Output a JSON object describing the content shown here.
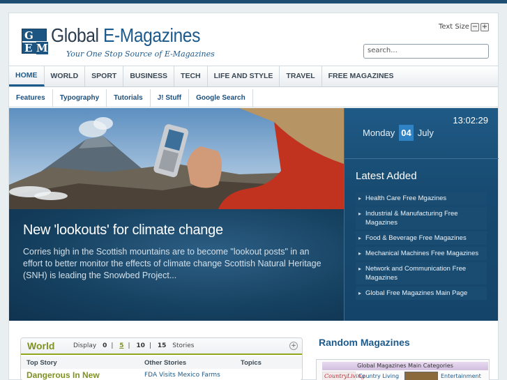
{
  "header": {
    "logo_letters": [
      "G",
      "E",
      "M"
    ],
    "title_part1": "Global ",
    "title_part2": "E-Magazines",
    "tagline": "Your One Stop Source of E-Magazines",
    "text_size_label": "Text Size",
    "text_size_minus": "−",
    "text_size_plus": "+",
    "search_placeholder": "search..."
  },
  "main_nav": [
    "HOME",
    "WORLD",
    "SPORT",
    "BUSINESS",
    "TECH",
    "LIFE AND STYLE",
    "TRAVEL",
    "FREE MAGAZINES"
  ],
  "sub_nav": [
    "Features",
    "Typography",
    "Tutorials",
    "J! Stuff",
    "Google Search"
  ],
  "hero": {
    "title": "New 'lookouts' for climate change",
    "text": "Corries high in the Scottish mountains are to become \"lookout posts\" in an effort to better monitor the effects of climate change Scottish Natural Heritage (SNH) is leading the Snowbed Project..."
  },
  "sidebar": {
    "time": "13:02:29",
    "weekday": "Monday",
    "day": "04",
    "month": "July",
    "latest_title": "Latest Added",
    "latest_items": [
      "Health Care Free Mgazines",
      "Industrial & Manufacturing Free Magazines",
      "Food & Beverage Free Magazines",
      "Mechanical Machines Free Magazines",
      "Network and Communication Free Magazines",
      "Global Free Magazines Main Page"
    ]
  },
  "world": {
    "title": "World",
    "display_label": "Display",
    "options": [
      "0",
      "5",
      "10",
      "15"
    ],
    "selected": "5",
    "stories_label": "Stories",
    "columns": [
      "Top Story",
      "Other Stories",
      "Topics"
    ],
    "row_partial": "Dangerous In New",
    "row_partial2": "FDA Visits Mexico Farms"
  },
  "random": {
    "title": "Random Magazines",
    "categories_header": "Global Magazines Main Categories",
    "cat1": "Country Living",
    "cat2": "Entertainment",
    "thumb1_text": "CountryLiving"
  },
  "colors": {
    "brand_blue": "#1d5a8c",
    "accent_green": "#7f9121",
    "hero_dark": "#123d5e"
  }
}
